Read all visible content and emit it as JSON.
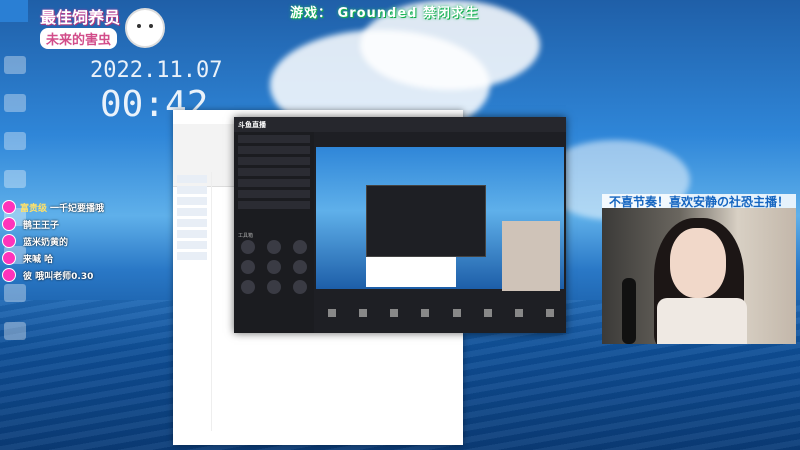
{
  "overlay": {
    "game_title": "游戏： Grounded 禁闭求生",
    "streamer_tag": "最佳饲养员",
    "streamer_sub": "未来的害虫",
    "date": "2022.11.07",
    "time": "00:42"
  },
  "chat": [
    {
      "name": "富贵级",
      "msg": "一千妃要播哦"
    },
    {
      "name": "",
      "msg": "鹊王王子"
    },
    {
      "name": "",
      "msg": "蓝米奶黄的"
    },
    {
      "name": "",
      "msg": "来喊 哈"
    },
    {
      "name": "",
      "msg": "彼 哦叫老师0.30"
    }
  ],
  "webcam": {
    "banner": "不喜节奏！喜欢安静の社恐主播！"
  },
  "app": {
    "logo": "斗鱼直播",
    "tag": "工具箱"
  },
  "colors": {
    "sky": "#2f86d8",
    "accent": "#d24d8a"
  }
}
